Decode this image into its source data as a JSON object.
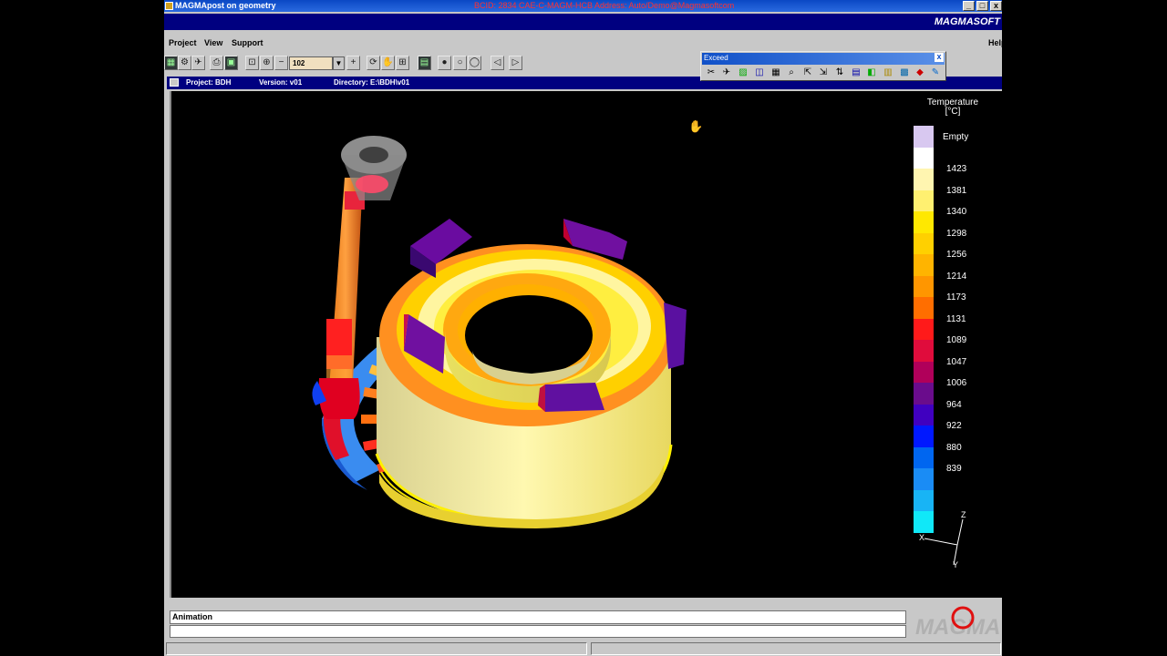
{
  "window": {
    "title": "MAGMApost on geometry",
    "licence_text": "BCID: 2834  CAE-C-MAGM-HCB  Address: Auto/Demo@Magmasoftcom",
    "brand": "MAGMASOFT",
    "minimize": "_",
    "maximize": "□",
    "close": "x"
  },
  "menu": {
    "project": "Project",
    "view": "View",
    "support": "Support",
    "help": "Help"
  },
  "toolbar": {
    "zoom_value": "102",
    "zoom_dropdown": "▼",
    "minus": "−",
    "plus": "+",
    "prev": "◁",
    "next": "▷"
  },
  "exceed": {
    "title": "Exceed",
    "close": "x"
  },
  "infobar": {
    "project": "Project: BDH",
    "version": "Version: v01",
    "directory": "Directory: E:\\BDH\\v01"
  },
  "legend": {
    "title": "Temperature",
    "unit": "[°C]",
    "empty_label": "Empty",
    "colors": [
      "#d8c8f0",
      "#ffffff",
      "#fff5b0",
      "#fff070",
      "#ffe800",
      "#ffd000",
      "#ffb400",
      "#ff9600",
      "#ff6e00",
      "#ff1a1a",
      "#e00c3c",
      "#b0005a",
      "#6a0c8c",
      "#4000c0",
      "#0018ff",
      "#0066f0",
      "#1a8cf5",
      "#18b4f5",
      "#10e8f8"
    ],
    "labels": [
      "1423",
      "1381",
      "1340",
      "1298",
      "1256",
      "1214",
      "1173",
      "1131",
      "1089",
      "1047",
      "1006",
      "964",
      "922",
      "880",
      "839"
    ]
  },
  "axes": {
    "x": "X",
    "y": "Y",
    "z": "Z"
  },
  "status": {
    "animation_label": "Animation",
    "logo": "MAGMA"
  }
}
